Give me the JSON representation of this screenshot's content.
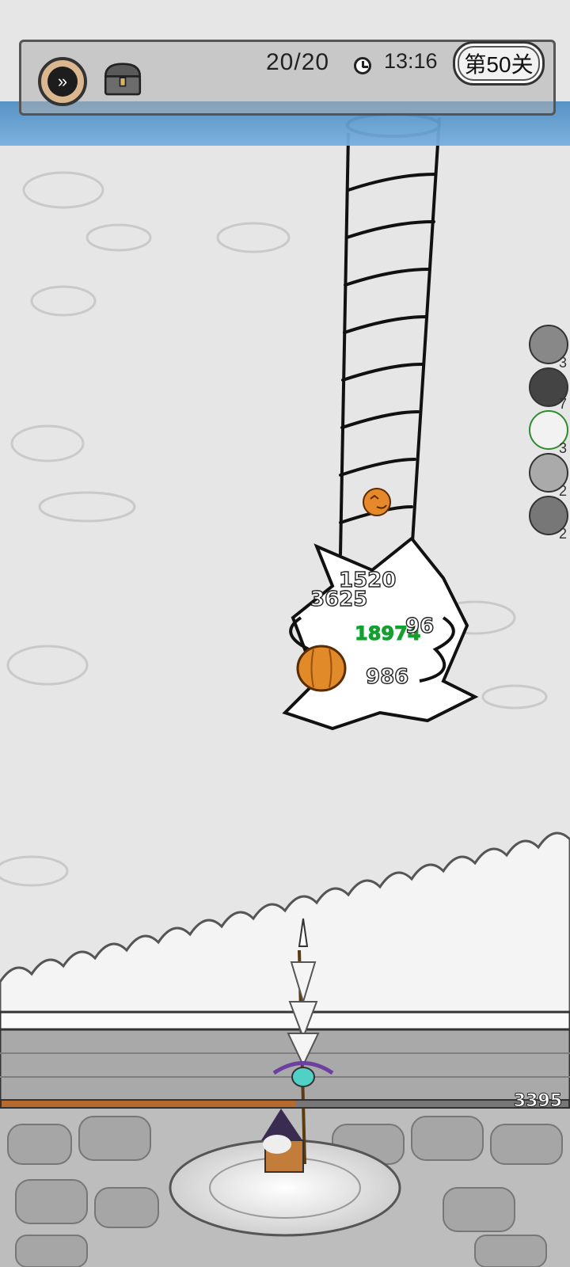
{
  "hud": {
    "wave": "20/20",
    "time": "13:16",
    "level": "第50关"
  },
  "skills": [
    {
      "icon": "rock-skill-icon",
      "count": "3"
    },
    {
      "icon": "black-orb-skill-icon",
      "count": "7"
    },
    {
      "icon": "tornado-skill-icon",
      "count": "3"
    },
    {
      "icon": "lightning-skill-icon",
      "count": "2"
    },
    {
      "icon": "crystal-skill-icon",
      "count": "2"
    }
  ],
  "damage_numbers": [
    "1520",
    "3625",
    "18974",
    "96",
    "986"
  ],
  "base": {
    "hp": "3395",
    "hp_fraction": 0.52
  },
  "colors": {
    "hud_blue": "#5e9ad0",
    "hp_fill": "#b86a2c",
    "crit_green": "#1e9b2a"
  }
}
